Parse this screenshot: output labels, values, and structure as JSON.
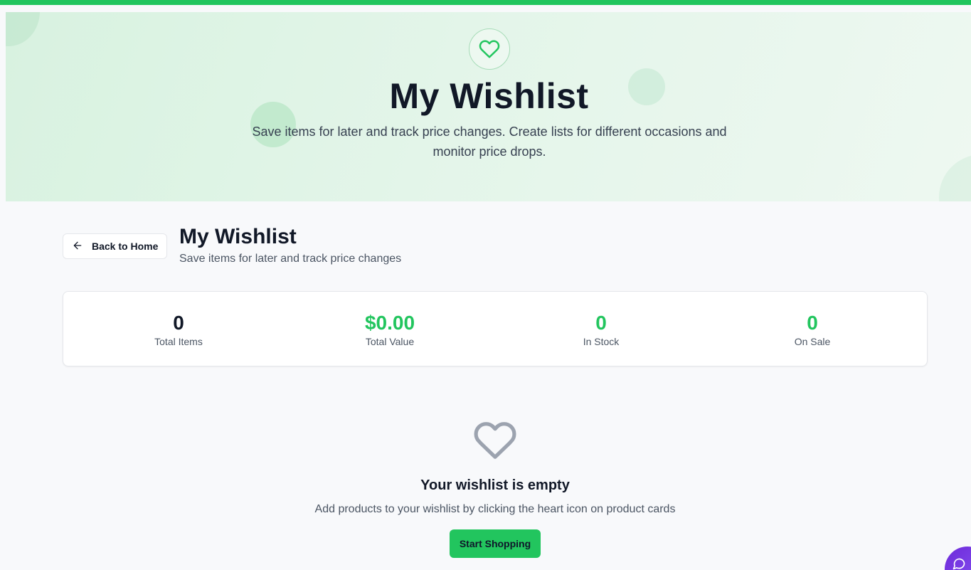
{
  "hero": {
    "icon": "heart-icon",
    "title": "My Wishlist",
    "subtitle": "Save items for later and track price changes. Create lists for different occasions and monitor price drops."
  },
  "header": {
    "back_label": "Back to Home",
    "back_icon": "arrow-left-icon",
    "title": "My Wishlist",
    "subtitle": "Save items for later and track price changes"
  },
  "stats": [
    {
      "value": "0",
      "label": "Total Items",
      "color": "#111827"
    },
    {
      "value": "$0.00",
      "label": "Total Value",
      "color": "#22c55e"
    },
    {
      "value": "0",
      "label": "In Stock",
      "color": "#22c55e"
    },
    {
      "value": "0",
      "label": "On Sale",
      "color": "#22c55e"
    }
  ],
  "empty_state": {
    "icon": "heart-outline-icon",
    "title": "Your wishlist is empty",
    "message": "Add products to your wishlist by clicking the heart icon on product cards",
    "button_label": "Start Shopping"
  },
  "colors": {
    "accent": "#22c55e",
    "chat": "#7c3aed"
  }
}
